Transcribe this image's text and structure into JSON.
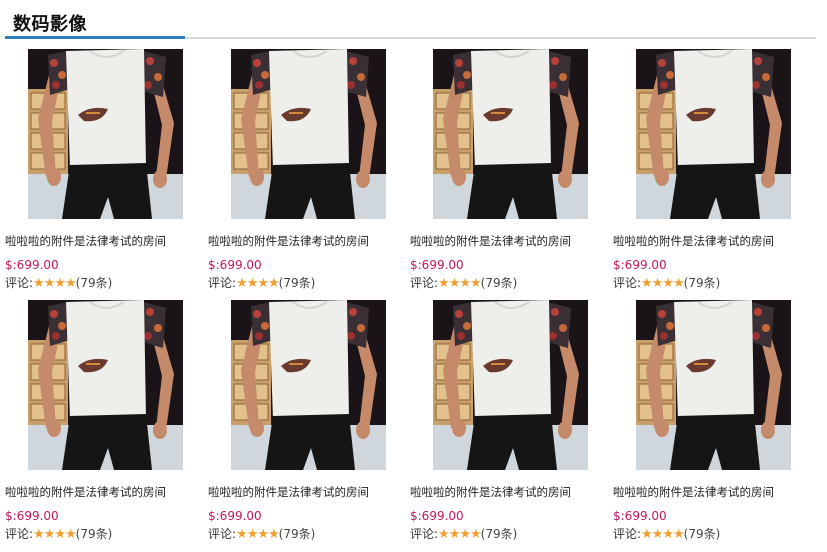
{
  "section": {
    "title": "数码影像"
  },
  "colors": {
    "accent": "#2b7bbd",
    "price": "#c2185b",
    "star": "#f0a030"
  },
  "products": [
    {
      "image": "product-photo-tshirt",
      "title": "啦啦啦的附件是法律考试的房间",
      "price": "$:699.00",
      "review_label": "评论:",
      "stars": "★★★★",
      "review_count": "(79条)"
    },
    {
      "image": "product-photo-tshirt",
      "title": "啦啦啦的附件是法律考试的房间",
      "price": "$:699.00",
      "review_label": "评论:",
      "stars": "★★★★",
      "review_count": "(79条)"
    },
    {
      "image": "product-photo-tshirt",
      "title": "啦啦啦的附件是法律考试的房间",
      "price": "$:699.00",
      "review_label": "评论:",
      "stars": "★★★★",
      "review_count": "(79条)"
    },
    {
      "image": "product-photo-tshirt",
      "title": "啦啦啦的附件是法律考试的房间",
      "price": "$:699.00",
      "review_label": "评论:",
      "stars": "★★★★",
      "review_count": "(79条)"
    },
    {
      "image": "product-photo-tshirt",
      "title": "啦啦啦的附件是法律考试的房间",
      "price": "$:699.00",
      "review_label": "评论:",
      "stars": "★★★★",
      "review_count": "(79条)"
    },
    {
      "image": "product-photo-tshirt",
      "title": "啦啦啦的附件是法律考试的房间",
      "price": "$:699.00",
      "review_label": "评论:",
      "stars": "★★★★",
      "review_count": "(79条)"
    },
    {
      "image": "product-photo-tshirt",
      "title": "啦啦啦的附件是法律考试的房间",
      "price": "$:699.00",
      "review_label": "评论:",
      "stars": "★★★★",
      "review_count": "(79条)"
    },
    {
      "image": "product-photo-tshirt",
      "title": "啦啦啦的附件是法律考试的房间",
      "price": "$:699.00",
      "review_label": "评论:",
      "stars": "★★★★",
      "review_count": "(79条)"
    }
  ]
}
